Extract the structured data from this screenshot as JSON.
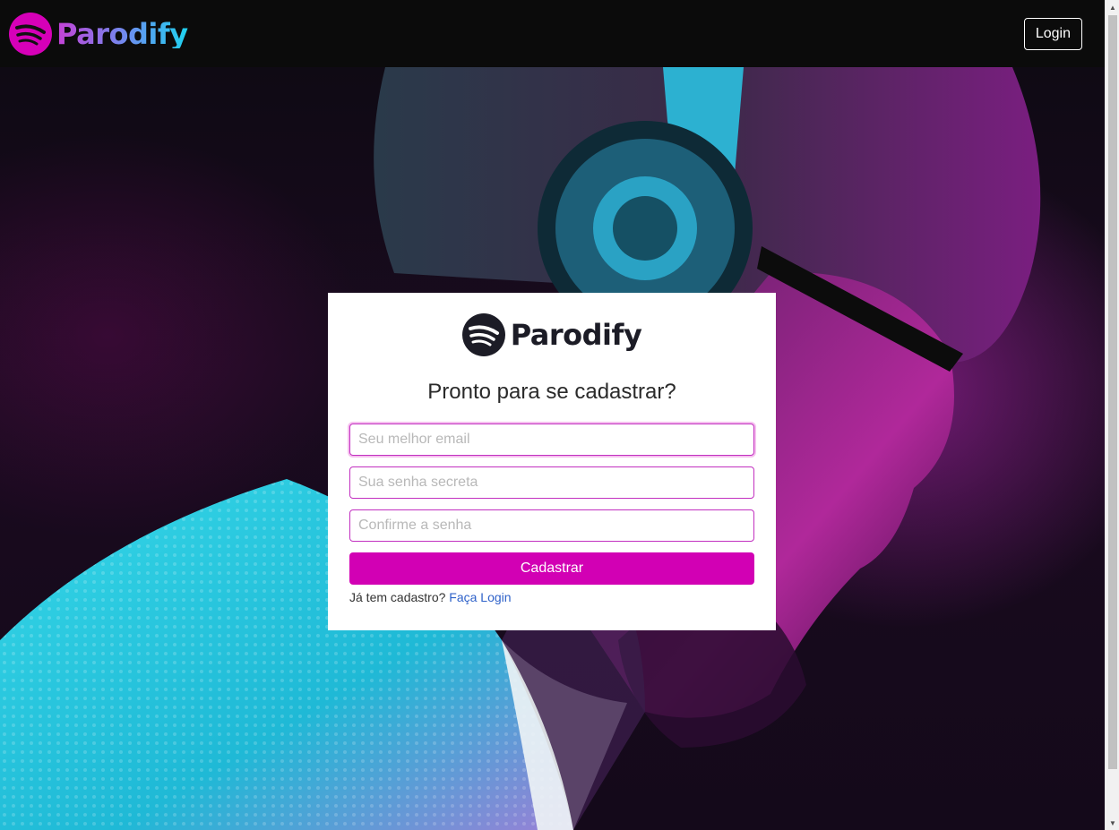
{
  "navbar": {
    "brand_name": "Parodify",
    "login_label": "Login"
  },
  "card": {
    "brand_name": "Parodify",
    "title": "Pronto para se cadastrar?",
    "email_placeholder": "Seu melhor email",
    "password_placeholder": "Sua senha secreta",
    "confirm_placeholder": "Confirme a senha",
    "submit_label": "Cadastrar",
    "footer_text": "Já tem cadastro?",
    "footer_link": "Faça Login"
  },
  "colors": {
    "accent": "#d200b4",
    "logo_circle": "#d600b8",
    "card_logo_circle": "#1c1c26",
    "link": "#2f62c9"
  },
  "icons": {
    "brand_logo": "parodify-logo-icon",
    "card_logo": "parodify-logo-icon"
  }
}
